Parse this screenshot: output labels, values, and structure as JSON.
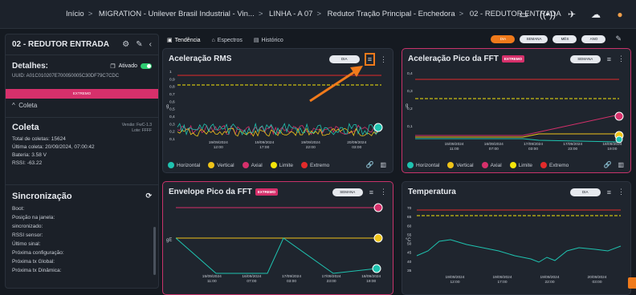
{
  "breadcrumb": [
    "Início",
    "MIGRATION - Unilever Brasil Industrial - Vin...",
    "LINHA - A 07",
    "Redutor Tração Principal - Enchedora",
    "02 - REDUTOR ENTRADA"
  ],
  "topbar_icons": [
    "monitor-icon",
    "signal-icon",
    "satellite-icon",
    "cloud-icon",
    "user-icon"
  ],
  "sidebar": {
    "title": "02 - REDUTOR ENTRADA",
    "details_label": "Detalhes:",
    "activated_label": "Ativado",
    "uuid": "UUID: A01C010207E700050005C30DF79C7CDC",
    "pink_label": "EXTREMO",
    "collapse_label": "Coleta",
    "coleta": {
      "title": "Coleta",
      "version": "Versão: FwC-1.3",
      "lote": "Lote: FFFF",
      "lines": [
        "Total de coletas: 15624",
        "Última coleta: 20/09/2024, 07:00:42",
        "Bateria: 3.58 V",
        "RSSI: -63.22"
      ]
    },
    "sinc": {
      "title": "Sincronização",
      "lines": [
        "Boot:",
        "Posição na janela:",
        "sincronizado:",
        "RSSI sensor:",
        "Último sinal:",
        "Próxima configuração:",
        "Próxima tx Global:",
        "Próxima tx Dinâmica:"
      ]
    }
  },
  "tabs": [
    "Tendência",
    "Espectros",
    "Histórico"
  ],
  "periods": [
    "DIA",
    "SEMANA",
    "MÊS",
    "ANO"
  ],
  "legend": [
    "Horizontal",
    "Vertical",
    "Axial",
    "Limite",
    "Extremo"
  ],
  "colors": {
    "horizontal": "#1fc3b0",
    "vertical": "#f0c419",
    "axial": "#d6306b",
    "limite": "#f5e50a",
    "extremo": "#e32b2b",
    "accent": "#f07a1b"
  },
  "cards": {
    "rms": {
      "title": "Aceleração RMS",
      "period": "DIA",
      "ylabel": "g",
      "yticks": [
        "1",
        "0,9",
        "0,8",
        "0,7",
        "0,6",
        "0,5",
        "0,4",
        "0,3",
        "0,2",
        "0,1"
      ],
      "xticks": [
        "19/09/2024\n12:00",
        "19/09/2024\n17:00",
        "19/09/2024\n22:00",
        "20/09/2024\n03:00"
      ]
    },
    "fft": {
      "title": "Aceleração Pico da FFT",
      "badge": "EXTREMO",
      "period": "SEMANA",
      "ylabel": "g",
      "yticks": [
        "0,4",
        "0,3",
        "0,2",
        "0,1"
      ],
      "xticks": [
        "15/09/2024\n11:00",
        "16/09/2024\n07:00",
        "17/09/2024\n03:00",
        "17/09/2024\n23:00",
        "18/09/2024\n19:00"
      ]
    },
    "env": {
      "title": "Envelope Pico da FFT",
      "badge": "EXTREMO",
      "period": "SEMANA",
      "ylabel": "gE",
      "xticks": [
        "15/09/2024\n11:00",
        "16/09/2024\n07:00",
        "17/09/2024\n03:00",
        "17/09/2024\n23:00",
        "18/09/2024\n19:00"
      ]
    },
    "temp": {
      "title": "Temperatura",
      "period": "DIA",
      "ylabel": "°C",
      "yticks": [
        "70",
        "65",
        "60",
        "55",
        "50",
        "45",
        "40",
        "35"
      ],
      "xticks": [
        "19/09/2024\n12:00",
        "19/09/2024\n17:00",
        "19/09/2024\n22:00",
        "20/09/2024\n03:00"
      ]
    }
  }
}
